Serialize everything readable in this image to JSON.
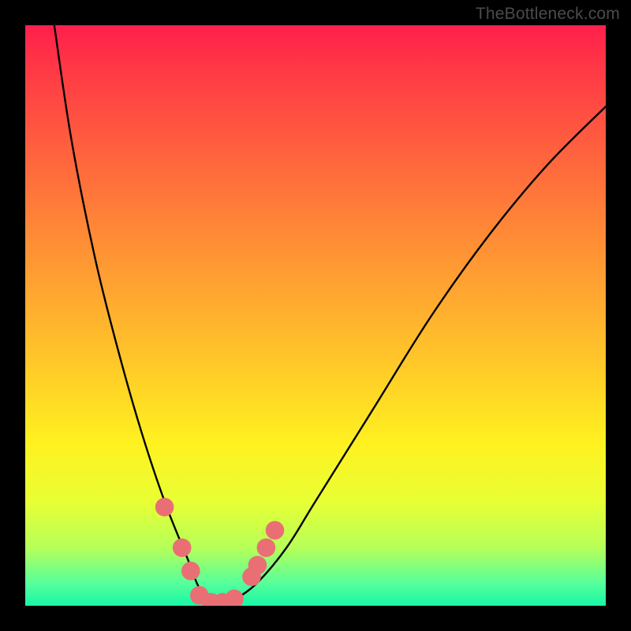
{
  "source_label": "TheBottleneck.com",
  "chart_data": {
    "type": "line",
    "title": "",
    "xlabel": "",
    "ylabel": "",
    "xlim": [
      0,
      100
    ],
    "ylim": [
      0,
      100
    ],
    "series": [
      {
        "name": "bottleneck-curve",
        "x": [
          5,
          8,
          12,
          16,
          20,
          24,
          28,
          30,
          32,
          34,
          36,
          40,
          45,
          50,
          60,
          70,
          80,
          90,
          100
        ],
        "y": [
          100,
          80,
          60,
          44,
          30,
          18,
          8,
          3,
          1,
          0,
          1,
          4,
          10,
          18,
          34,
          50,
          64,
          76,
          86
        ]
      }
    ],
    "markers": [
      {
        "name": "left-marker-1",
        "x": 24,
        "y": 17,
        "r": 1.6
      },
      {
        "name": "left-marker-2",
        "x": 27,
        "y": 10,
        "r": 1.6
      },
      {
        "name": "left-marker-3",
        "x": 28.5,
        "y": 6,
        "r": 1.6
      },
      {
        "name": "valley-marker-1",
        "x": 30,
        "y": 1.8,
        "r": 1.6
      },
      {
        "name": "valley-marker-2",
        "x": 32,
        "y": 0.6,
        "r": 1.6
      },
      {
        "name": "valley-marker-3",
        "x": 34,
        "y": 0.6,
        "r": 1.6
      },
      {
        "name": "valley-marker-4",
        "x": 36,
        "y": 1.2,
        "r": 1.6
      },
      {
        "name": "right-marker-1",
        "x": 39,
        "y": 5,
        "r": 1.6
      },
      {
        "name": "right-marker-2",
        "x": 40,
        "y": 7,
        "r": 1.6
      },
      {
        "name": "right-marker-3",
        "x": 41.5,
        "y": 10,
        "r": 1.6
      },
      {
        "name": "right-marker-4",
        "x": 43,
        "y": 13,
        "r": 1.6
      }
    ],
    "marker_color": "#e96f74"
  }
}
